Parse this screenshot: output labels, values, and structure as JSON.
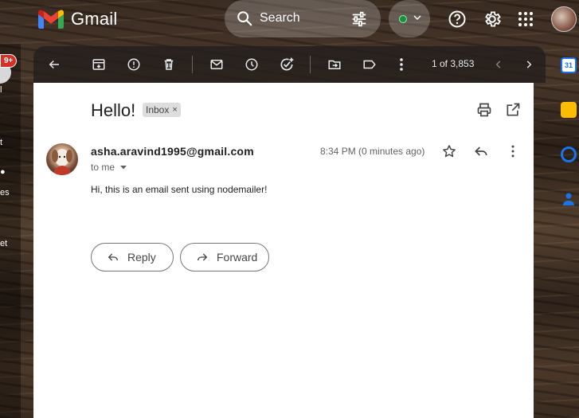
{
  "app": {
    "name": "Gmail"
  },
  "search": {
    "label": "Search"
  },
  "leftnav": {
    "badge": "9+",
    "items": [
      "l",
      "t",
      "es",
      "et"
    ]
  },
  "toolbar": {
    "pager": "1 of 3,853"
  },
  "email": {
    "subject": "Hello!",
    "label": "Inbox",
    "label_close": "×",
    "sender": "asha.aravind1995@gmail.com",
    "recipient": "to me",
    "time": "8:34 PM (0 minutes ago)",
    "body": "Hi, this is an email sent using nodemailer!"
  },
  "actions": {
    "reply": "Reply",
    "forward": "Forward"
  },
  "sidepanel": {
    "calendar_day": "31"
  },
  "colors": {
    "status": "#1e8e3e",
    "badge": "#d93025",
    "calendar": "#1a73e8",
    "keep": "#fbbc04",
    "tasks": "#1a73e8",
    "contacts": "#1a73e8"
  }
}
